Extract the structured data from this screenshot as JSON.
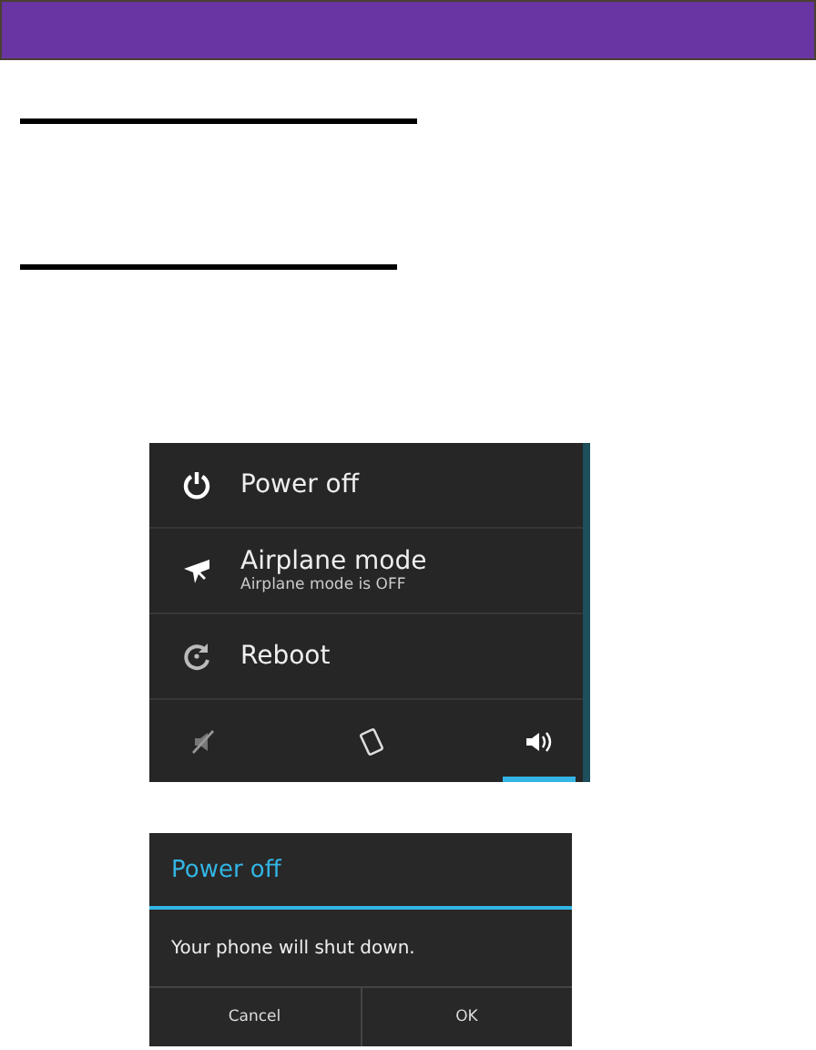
{
  "power_menu": {
    "items": [
      {
        "kind": "power",
        "title": "Power off"
      },
      {
        "kind": "airplane",
        "title": "Airplane mode",
        "subtitle": "Airplane mode is OFF"
      },
      {
        "kind": "reboot",
        "title": "Reboot"
      }
    ],
    "sound_modes": [
      {
        "kind": "silent",
        "selected": false
      },
      {
        "kind": "vibrate",
        "selected": false
      },
      {
        "kind": "sound",
        "selected": true
      }
    ]
  },
  "dialog": {
    "title": "Power off",
    "message": "Your phone will shut down.",
    "buttons": [
      "Cancel",
      "OK"
    ]
  }
}
